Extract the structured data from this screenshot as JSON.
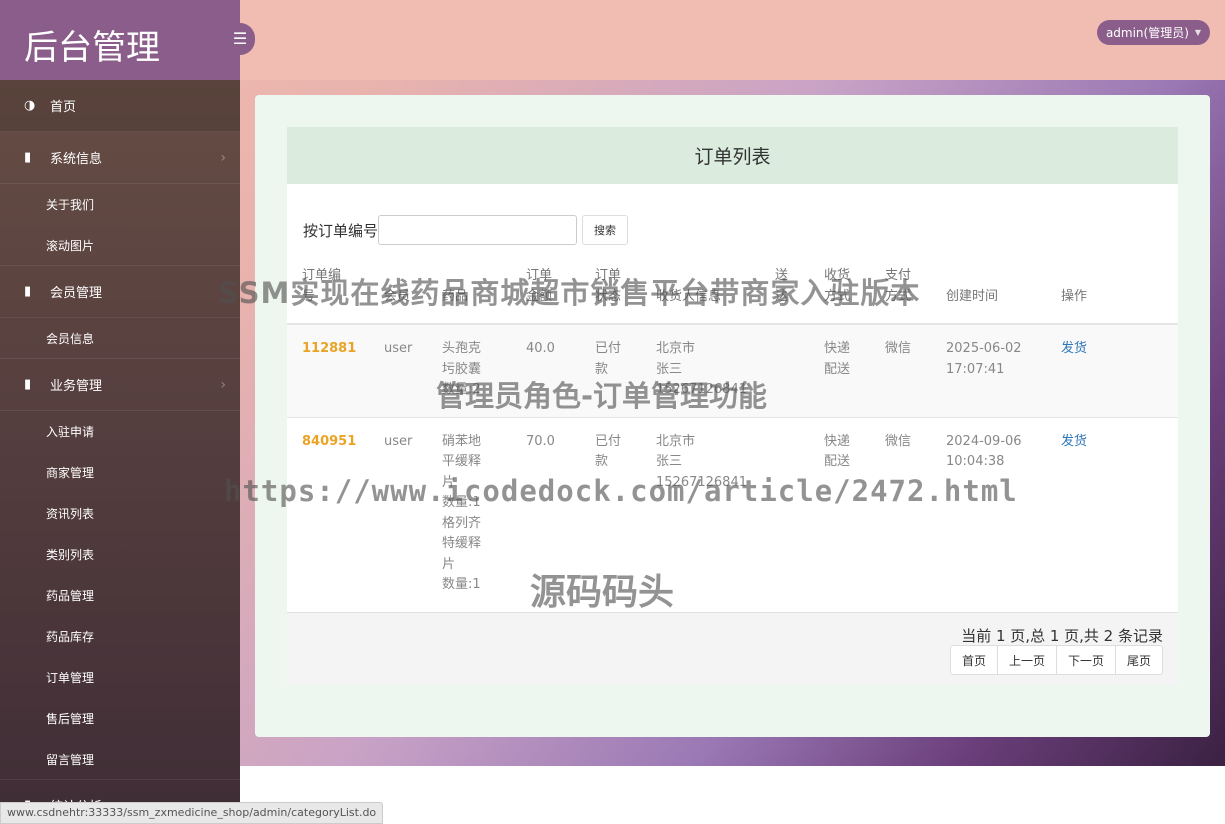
{
  "app": {
    "title": "后台管理",
    "toggle_icon": "menu-icon"
  },
  "user": {
    "label": "admin(管理员)"
  },
  "sidebar": {
    "home": "首页",
    "groups": [
      {
        "label": "系统信息",
        "items": [
          "关于我们",
          "滚动图片"
        ]
      },
      {
        "label": "会员管理",
        "items": [
          "会员信息"
        ]
      },
      {
        "label": "业务管理",
        "items": [
          "入驻申请",
          "商家管理",
          "资讯列表",
          "类别列表",
          "药品管理",
          "药品库存",
          "订单管理",
          "售后管理",
          "留言管理"
        ]
      },
      {
        "label": "统计分析",
        "items": []
      }
    ]
  },
  "main": {
    "title": "订单列表",
    "search": {
      "label": "按订单编号",
      "value": "",
      "button": "搜索"
    },
    "table": {
      "headers": [
        "订单编号",
        "会员",
        "药品",
        "订单金额",
        "订单状态",
        "收货人信息",
        "送达",
        "收货方式",
        "支付方式",
        "创建时间",
        "操作"
      ],
      "rows": [
        {
          "order_no": "112881",
          "member": "user",
          "drug": [
            "头孢克",
            "圬胶囊",
            "数量:2"
          ],
          "amount": "40.0",
          "status": [
            "已付",
            "款"
          ],
          "receiver": [
            "北京市",
            "张三",
            "15267126841"
          ],
          "delivery": "",
          "ship_method": [
            "快递",
            "配送"
          ],
          "pay": "微信",
          "created": [
            "2025-06-02",
            "17:07:41"
          ],
          "action": "发货"
        },
        {
          "order_no": "840951",
          "member": "user",
          "drug": [
            "硝苯地",
            "平缓释",
            "片",
            "数量:1",
            "格列齐",
            "特缓释",
            "片",
            "数量:1"
          ],
          "amount": "70.0",
          "status": [
            "已付",
            "款"
          ],
          "receiver": [
            "北京市",
            "张三",
            "15267126841"
          ],
          "delivery": "",
          "ship_method": [
            "快递",
            "配送"
          ],
          "pay": "微信",
          "created": [
            "2024-09-06",
            "10:04:38"
          ],
          "action": "发货"
        }
      ]
    },
    "pager": {
      "summary": "当前 1 页,总 1 页,共 2 条记录",
      "buttons": [
        "首页",
        "上一页",
        "下一页",
        "尾页"
      ]
    }
  },
  "watermark": {
    "line1": "SSM实现在线药品商城超市销售平台带商家入驻版本",
    "line2": "管理员角色-订单管理功能",
    "line3": "https://www.icodedock.com/article/2472.html",
    "line4": "源码码头"
  },
  "status_bar": {
    "url": "www.csdnehtr:33333/ssm_zxmedicine_shop/admin/categoryList.do"
  }
}
